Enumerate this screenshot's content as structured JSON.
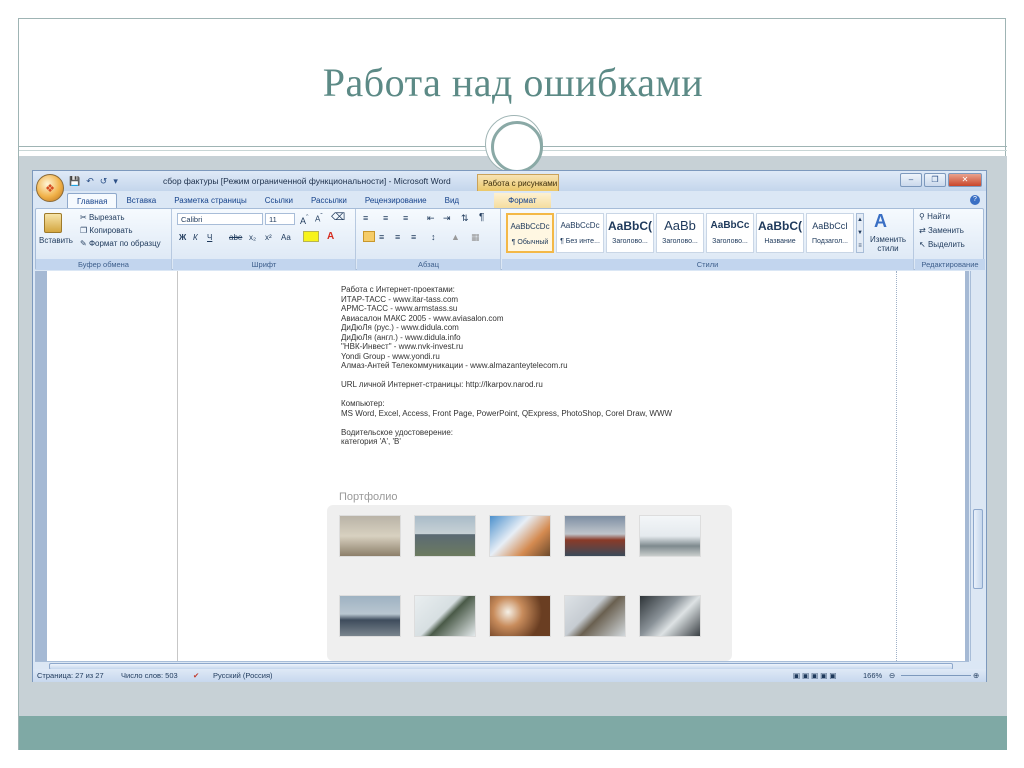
{
  "slide": {
    "title": "Работа над ошибками"
  },
  "word": {
    "window_title": "сбор фактуры [Режим ограниченной функциональности] - Microsoft Word",
    "context_tab": "Работа с рисунками",
    "tabs": [
      "Главная",
      "Вставка",
      "Разметка страницы",
      "Ссылки",
      "Рассылки",
      "Рецензирование",
      "Вид",
      "Формат"
    ],
    "ribbon": {
      "clipboard": {
        "paste": "Вставить",
        "cut": "Вырезать",
        "copy": "Копировать",
        "format_painter": "Формат по образцу",
        "label": "Буфер обмена"
      },
      "font": {
        "name": "Calibri",
        "size": "11",
        "label": "Шрифт",
        "bold": "Ж",
        "italic": "К",
        "underline": "Ч",
        "strike": "abe",
        "subscript": "x₂",
        "superscript": "x²",
        "case": "Aa"
      },
      "paragraph": {
        "label": "Абзац"
      },
      "styles": {
        "label": "Стили",
        "items": [
          {
            "sample": "AaBbCcDc",
            "name": "¶ Обычный"
          },
          {
            "sample": "AaBbCcDc",
            "name": "¶ Без инте..."
          },
          {
            "sample": "AaBbC(",
            "name": "Заголово..."
          },
          {
            "sample": "AaBb",
            "name": "Заголово..."
          },
          {
            "sample": "AaBbCc",
            "name": "Заголово..."
          },
          {
            "sample": "AaBbC(",
            "name": "Название"
          },
          {
            "sample": "AaBbCcI",
            "name": "Подзагол..."
          }
        ],
        "change_styles": "Изменить стили"
      },
      "editing": {
        "label": "Редактирование",
        "find": "Найти",
        "replace": "Заменить",
        "select": "Выделить"
      }
    },
    "document": {
      "lines": [
        "Работа с Интернет-проектами:",
        "ИТАР-ТАСС - www.itar-tass.com",
        "АРМС-ТАСС - www.armstass.su",
        "Авиасалон МАКС 2005 - www.aviasalon.com",
        "ДиДюЛя (рус.) - www.didula.com",
        "ДиДюЛя (англ.) - www.didula.info",
        "\"НВК-Инвест\" - www.nvk-invest.ru",
        "Yondi Group - www.yondi.ru",
        "Алмаз-Антей Телекоммуникации - www.almazanteytelecom.ru",
        "",
        "URL личной Интернет-страницы: http://lkarpov.narod.ru",
        "",
        "Компьютер:",
        "MS Word, Excel, Access, Front Page, PowerPoint, QExpress, PhotoShop, Corel Draw, WWW",
        "",
        "Водительское удостоверение:",
        "категория 'A', 'B'"
      ],
      "portfolio_title": "Портфолио"
    },
    "status": {
      "page": "Страница: 27 из 27",
      "words": "Число слов: 503",
      "language": "Русский (Россия)",
      "zoom": "166%"
    }
  }
}
